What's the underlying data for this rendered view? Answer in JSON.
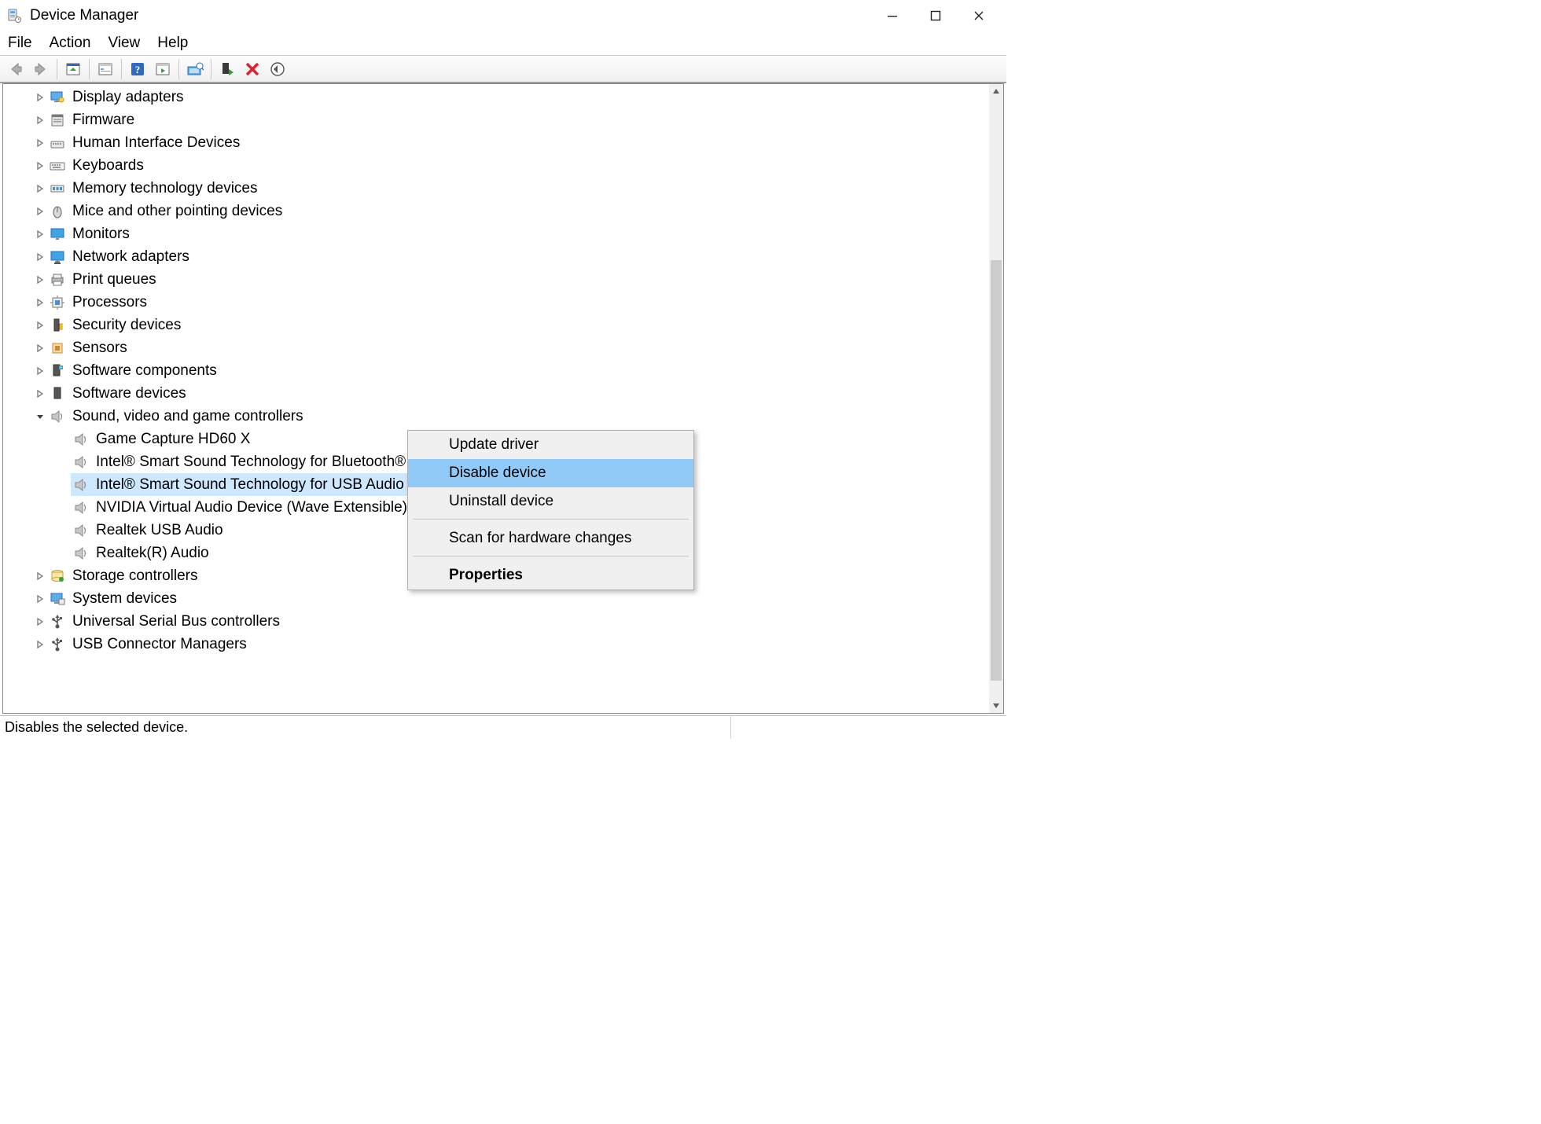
{
  "window": {
    "title": "Device Manager"
  },
  "menu": {
    "file": "File",
    "action": "Action",
    "view": "View",
    "help": "Help"
  },
  "toolbar_icons": {
    "back": "back-icon",
    "forward": "forward-icon",
    "show_tree": "show-tree-icon",
    "properties_sheet": "properties-sheet-icon",
    "help": "help-icon",
    "action_pane": "action-pane-icon",
    "show_hidden": "show-hidden-icon",
    "update_driver": "update-driver-icon",
    "uninstall": "uninstall-icon",
    "scan": "scan-hardware-icon"
  },
  "tree": [
    {
      "label": "Display adapters",
      "icon": "display-adapter-icon",
      "expanded": false,
      "children": []
    },
    {
      "label": "Firmware",
      "icon": "firmware-icon",
      "expanded": false,
      "children": []
    },
    {
      "label": "Human Interface Devices",
      "icon": "hid-icon",
      "expanded": false,
      "children": []
    },
    {
      "label": "Keyboards",
      "icon": "keyboard-icon",
      "expanded": false,
      "children": []
    },
    {
      "label": "Memory technology devices",
      "icon": "memory-icon",
      "expanded": false,
      "children": []
    },
    {
      "label": "Mice and other pointing devices",
      "icon": "mouse-icon",
      "expanded": false,
      "children": []
    },
    {
      "label": "Monitors",
      "icon": "monitor-icon",
      "expanded": false,
      "children": []
    },
    {
      "label": "Network adapters",
      "icon": "network-icon",
      "expanded": false,
      "children": []
    },
    {
      "label": "Print queues",
      "icon": "printer-icon",
      "expanded": false,
      "children": []
    },
    {
      "label": "Processors",
      "icon": "processor-icon",
      "expanded": false,
      "children": []
    },
    {
      "label": "Security devices",
      "icon": "security-icon",
      "expanded": false,
      "children": []
    },
    {
      "label": "Sensors",
      "icon": "sensor-icon",
      "expanded": false,
      "children": []
    },
    {
      "label": "Software components",
      "icon": "software-comp-icon",
      "expanded": false,
      "children": []
    },
    {
      "label": "Software devices",
      "icon": "software-dev-icon",
      "expanded": false,
      "children": []
    },
    {
      "label": "Sound, video and game controllers",
      "icon": "sound-icon",
      "expanded": true,
      "children": [
        {
          "label": "Game Capture HD60 X",
          "icon": "sound-icon",
          "selected": false
        },
        {
          "label": "Intel® Smart Sound Technology for Bluetooth® Audio",
          "icon": "sound-icon",
          "selected": false
        },
        {
          "label": "Intel® Smart Sound Technology for USB Audio",
          "icon": "sound-icon",
          "selected": true
        },
        {
          "label": "NVIDIA Virtual Audio Device (Wave Extensible) (WDM)",
          "icon": "sound-icon",
          "selected": false
        },
        {
          "label": "Realtek USB Audio",
          "icon": "sound-icon",
          "selected": false
        },
        {
          "label": "Realtek(R) Audio",
          "icon": "sound-icon",
          "selected": false
        }
      ]
    },
    {
      "label": "Storage controllers",
      "icon": "storage-icon",
      "expanded": false,
      "children": []
    },
    {
      "label": "System devices",
      "icon": "system-icon",
      "expanded": false,
      "children": []
    },
    {
      "label": "Universal Serial Bus controllers",
      "icon": "usb-icon",
      "expanded": false,
      "children": []
    },
    {
      "label": "USB Connector Managers",
      "icon": "usb-icon",
      "expanded": false,
      "children": []
    }
  ],
  "context_menu": {
    "items": [
      {
        "label": "Update driver",
        "type": "item"
      },
      {
        "label": "Disable device",
        "type": "item",
        "highlighted": true
      },
      {
        "label": "Uninstall device",
        "type": "item"
      },
      {
        "type": "sep"
      },
      {
        "label": "Scan for hardware changes",
        "type": "item"
      },
      {
        "type": "sep"
      },
      {
        "label": "Properties",
        "type": "item",
        "bold": true
      }
    ]
  },
  "status_bar": {
    "text": "Disables the selected device."
  }
}
